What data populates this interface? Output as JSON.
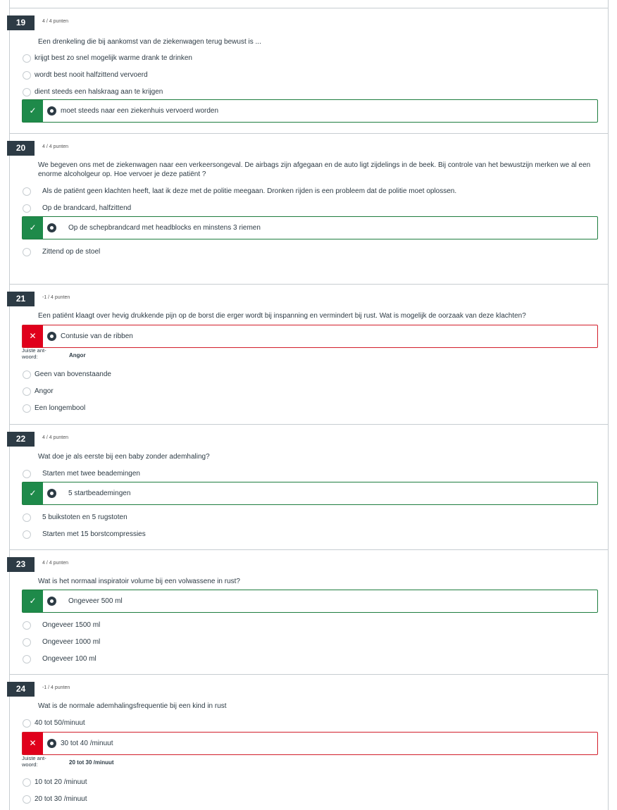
{
  "questions": [
    {
      "number": "19",
      "points": "4 / 4 punten",
      "text": "Een drenkeling die bij aankomst van de ziekenwagen terug bewust is ...",
      "options": [
        "krijgt best zo snel mogelijk warme drank te drinken",
        "wordt best nooit halfzittend vervoerd",
        "dient steeds een halskraag aan te krijgen"
      ],
      "selected": "moet steeds naar een ziekenhuis vervoerd worden"
    },
    {
      "number": "20",
      "points": "4 / 4 punten",
      "text": "We begeven ons met de ziekenwagen naar een verkeersongeval. De airbags zijn afgegaan en de auto ligt zijdelings in de beek. Bij controle van het bewustzijn merken we al een enorme alcoholgeur op. Hoe vervoer je deze patiënt ?",
      "options": [
        "Als de patiënt geen klachten heeft, laat ik deze met de politie meegaan. Dronken rijden is een probleem dat de politie moet oplossen.",
        "Op de brandcard, halfzittend"
      ],
      "selected": "Op de schepbrandcard met headblocks en minstens 3 riemen",
      "options_after": [
        "Zittend op de stoel"
      ]
    },
    {
      "number": "21",
      "points": "-1 / 4 punten",
      "text": "Een patiënt klaagt over hevig drukkende pijn op de borst die erger wordt bij inspanning en vermindert bij rust. Wat is mogelijk de oorzaak van deze klachten?",
      "selected": "Contusie van de ribben",
      "correct_caption": "Juiste ant-woord:",
      "correct_answer": "Angor",
      "options_after": [
        "Geen van bovenstaande",
        "Angor",
        "Een longembool"
      ]
    },
    {
      "number": "22",
      "points": "4 / 4 punten",
      "text": "Wat doe je als eerste bij een baby zonder ademhaling?",
      "options": [
        "Starten met twee beademingen"
      ],
      "selected": "5 startbeademingen",
      "options_after": [
        "5 buikstoten en 5 rugstoten",
        "Starten met 15 borstcompressies"
      ]
    },
    {
      "number": "23",
      "points": "4 / 4 punten",
      "text": "Wat is het normaal inspiratoir volume bij een volwassene in rust?",
      "selected": "Ongeveer 500 ml",
      "options_after": [
        "Ongeveer 1500 ml",
        "Ongeveer 1000 ml",
        "Ongeveer 100 ml"
      ]
    },
    {
      "number": "24",
      "points": "-1 / 4 punten",
      "text": "Wat is de normale ademhalingsfrequentie bij een kind in rust",
      "options": [
        "40 tot 50/minuut"
      ],
      "selected": "30 tot 40 /minuut",
      "correct_caption": "Juiste ant-woord:",
      "correct_answer": "20 tot 30 /minuut",
      "options_after": [
        "10 tot 20 /minuut",
        "20 tot 30 /minuut"
      ]
    }
  ],
  "icons": {
    "correct": "check-icon",
    "wrong": "cross-icon"
  },
  "colors": {
    "correct": "#1e8a4a",
    "wrong": "#e0001b",
    "badge": "#2d3b45"
  }
}
